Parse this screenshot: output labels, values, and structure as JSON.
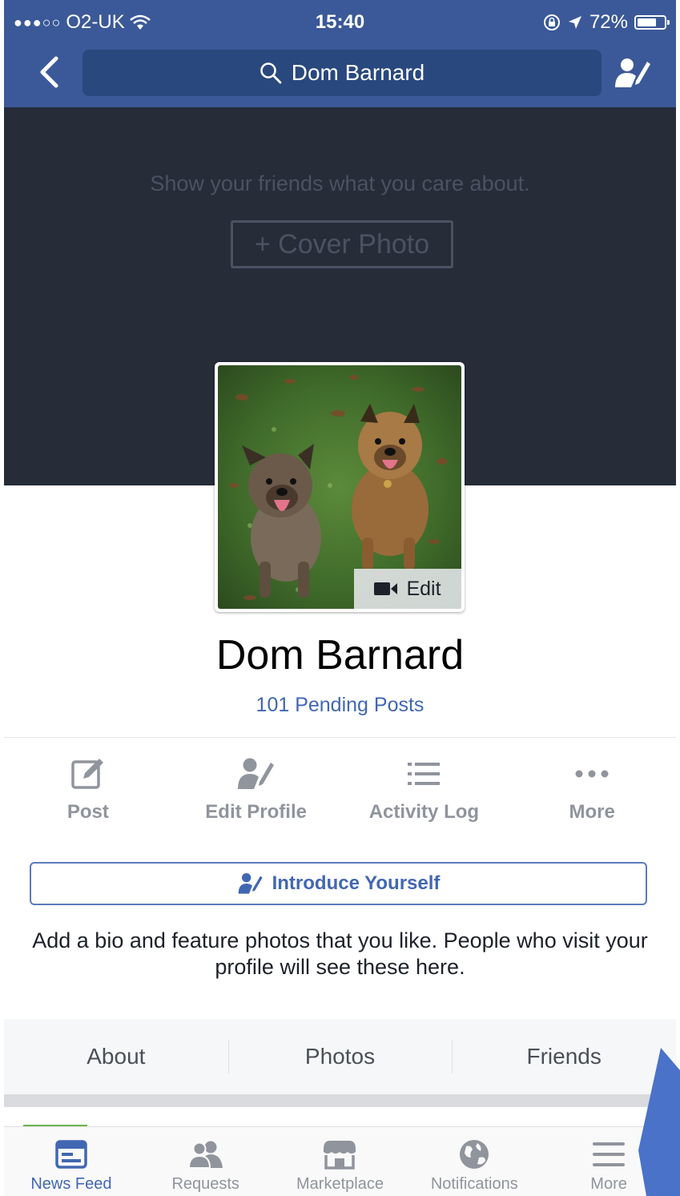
{
  "status_bar": {
    "carrier": "O2-UK",
    "time": "15:40",
    "battery": "72%",
    "battery_level": 0.72
  },
  "header": {
    "search_text": "Dom Barnard"
  },
  "cover": {
    "prompt": "Show your friends what you care about.",
    "button_label": "+ Cover Photo"
  },
  "profile": {
    "edit_label": "Edit",
    "name": "Dom Barnard",
    "pending": "101 Pending Posts"
  },
  "actions": [
    {
      "label": "Post",
      "icon": "compose-icon"
    },
    {
      "label": "Edit Profile",
      "icon": "edit-profile-icon"
    },
    {
      "label": "Activity Log",
      "icon": "list-icon"
    },
    {
      "label": "More",
      "icon": "more-dots-icon"
    }
  ],
  "intro": {
    "button_label": "Introduce Yourself",
    "description": "Add a bio and feature photos that you like. People who visit your profile will see these here."
  },
  "tabs": [
    "About",
    "Photos",
    "Friends"
  ],
  "bottom_nav": [
    {
      "label": "News Feed",
      "icon": "news-feed-icon",
      "active": true
    },
    {
      "label": "Requests",
      "icon": "friend-requests-icon",
      "active": false
    },
    {
      "label": "Marketplace",
      "icon": "marketplace-icon",
      "active": false
    },
    {
      "label": "Notifications",
      "icon": "globe-icon",
      "active": false
    },
    {
      "label": "More",
      "icon": "hamburger-icon",
      "active": false
    }
  ],
  "colors": {
    "brand": "#3b5998",
    "accent": "#4267b2",
    "cover": "#262c38"
  }
}
